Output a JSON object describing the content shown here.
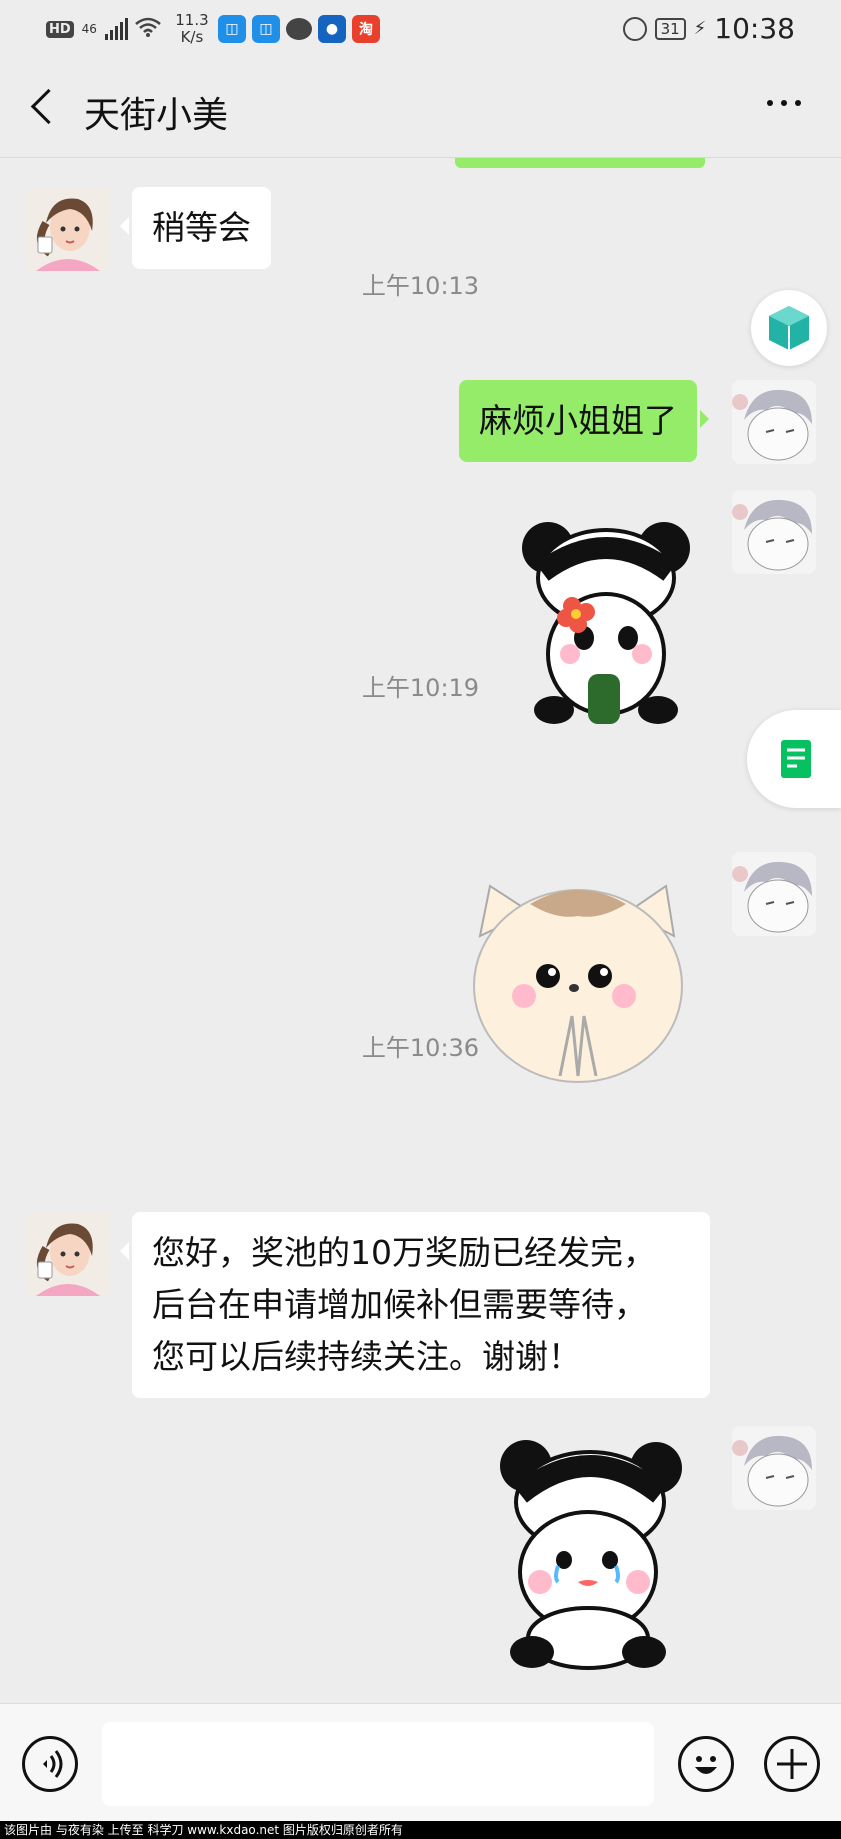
{
  "status_bar": {
    "hd": "HD",
    "network": "46",
    "speed_value": "11.3",
    "speed_unit": "K/s",
    "battery": "31",
    "time": "10:38"
  },
  "header": {
    "title": "天街小美"
  },
  "messages": [
    {
      "side": "left",
      "text": "稍等会"
    },
    {
      "timestamp": "上午10:13"
    },
    {
      "side": "right",
      "text": "麻烦小姐姐了"
    },
    {
      "side": "right",
      "sticker": "panda-with-flower"
    },
    {
      "timestamp": "上午10:19"
    },
    {
      "side": "right",
      "sticker": "cat-praying"
    },
    {
      "timestamp": "上午10:36"
    },
    {
      "side": "left",
      "lines": [
        "您好，奖池的10万奖励已经发完，",
        "后台在申请增加候补但需要等待，",
        "您可以后续持续关注。谢谢！"
      ]
    },
    {
      "side": "right",
      "sticker": "panda-crying"
    }
  ],
  "icons": {
    "back": "back-arrow-icon",
    "more": "more-icon",
    "voice": "voice-icon",
    "emoji": "emoji-icon",
    "plus": "plus-icon",
    "cube": "cube-icon",
    "doc": "document-icon"
  },
  "colors": {
    "sent_bubble": "#95ec69",
    "received_bubble": "#ffffff",
    "background": "#ededed"
  },
  "footer": {
    "text": "该图片由 与夜有染 上传至 科学刀 www.kxdao.net 图片版权归原创者所有"
  }
}
